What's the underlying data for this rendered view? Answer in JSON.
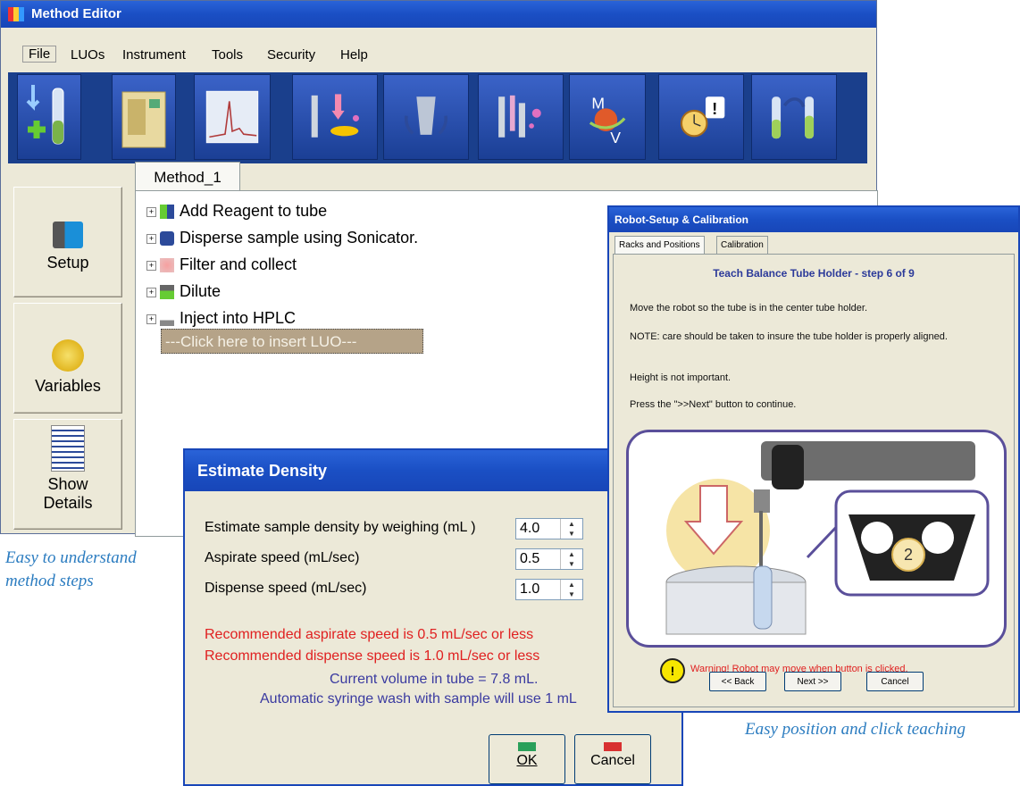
{
  "method_editor": {
    "title": "Method Editor",
    "menu": [
      "File",
      "LUOs",
      "Instrument",
      "Tools",
      "Security",
      "Help"
    ],
    "toolbar_icons": [
      "add-reagent-icon",
      "instrument-icon",
      "chromatogram-icon",
      "syringe-dispense-icon",
      "sonicator-icon",
      "filter-icon",
      "mv-variables-icon",
      "timer-alert-icon",
      "transfer-tube-icon",
      "vortex-tube-icon"
    ],
    "tab": "Method_1",
    "tree": [
      {
        "label": "Add Reagent to tube",
        "icon": "reagent-icon"
      },
      {
        "label": "Disperse sample using Sonicator.",
        "icon": "sonicator-icon"
      },
      {
        "label": "Filter and collect",
        "icon": "filter-icon"
      },
      {
        "label": "Dilute",
        "icon": "dilute-icon"
      },
      {
        "label": "Inject into HPLC",
        "icon": "hplc-icon"
      }
    ],
    "insert_luo": "---Click here to insert LUO---",
    "side_buttons": {
      "setup": "Setup",
      "variables": "Variables",
      "show": "Show",
      "details": "Details"
    }
  },
  "estimate_density": {
    "title": "Estimate Density",
    "fields": [
      {
        "label": "Estimate sample density by weighing (mL )",
        "value": "4.0"
      },
      {
        "label": "Aspirate speed (mL/sec)",
        "value": "0.5"
      },
      {
        "label": "Dispense speed (mL/sec)",
        "value": "1.0"
      }
    ],
    "warnings": [
      "Recommended aspirate speed is 0.5 mL/sec or less",
      "Recommended dispense speed is 1.0 mL/sec or less"
    ],
    "info": [
      "Current volume in tube = 7.8 mL.",
      "Automatic syringe wash with sample will use 1 mL"
    ],
    "ok": "OK",
    "cancel": "Cancel"
  },
  "robot_setup": {
    "title": "Robot-Setup & Calibration",
    "tabs": [
      "Racks and Positions",
      "Calibration"
    ],
    "heading": "Teach Balance Tube Holder - step 6 of 9",
    "lines": [
      "Move the robot so the tube is in the center tube holder.",
      "NOTE: care should be taken to insure the tube holder is properly aligned.",
      "Height is not important.",
      "Press the \">>Next\" button to continue."
    ],
    "holder_number": "2",
    "warning": "Warning!  Robot may move when button is clicked.",
    "buttons": {
      "back": "<< Back",
      "next": "Next >>",
      "cancel": "Cancel"
    }
  },
  "captions": {
    "left_1": "Easy to understand",
    "left_2": "method steps",
    "right": "Easy position and click teaching"
  },
  "colors": {
    "title_bar": "#1a4fc4",
    "warning_red": "#e02020",
    "info_blue": "#3a3aa0",
    "caption_blue": "#2b7cc0"
  }
}
